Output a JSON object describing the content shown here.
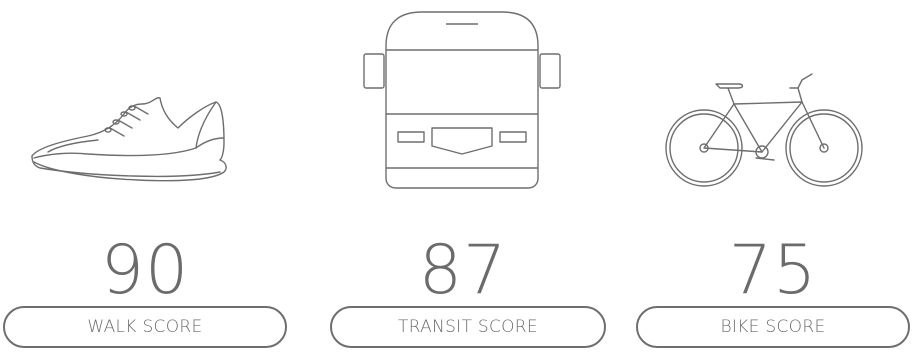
{
  "scores": [
    {
      "icon": "walking-shoe-icon",
      "value": "90",
      "label": "WALK SCORE"
    },
    {
      "icon": "bus-icon",
      "value": "87",
      "label": "TRANSIT SCORE"
    },
    {
      "icon": "bicycle-icon",
      "value": "75",
      "label": "BIKE SCORE"
    }
  ],
  "colors": {
    "line": "#6e6e6e",
    "text": "#6b6b6b",
    "background": "#ffffff"
  }
}
